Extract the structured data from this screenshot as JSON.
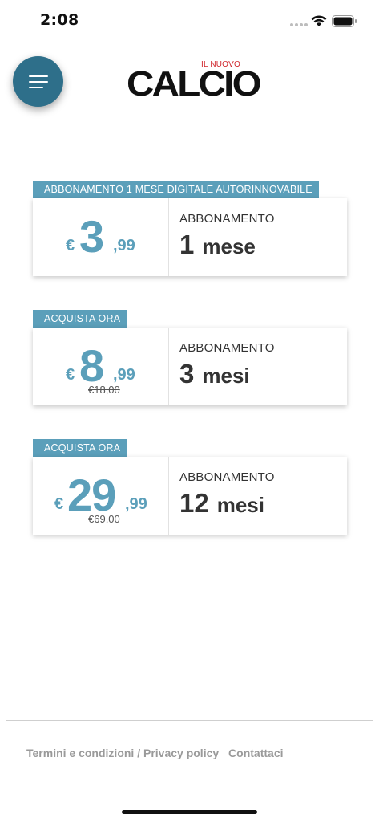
{
  "status_bar": {
    "time": "2:08"
  },
  "header": {
    "menu_icon": "hamburger-menu-icon",
    "logo_small": "IL NUOVO",
    "logo_main": "CALCIO"
  },
  "plans": [
    {
      "label": "ABBONAMENTO 1 MESE DIGITALE AUTORINNOVABILE",
      "currency": "€",
      "price_int": "3",
      "price_dec": ",99",
      "old_price": "",
      "title": "ABBONAMENTO",
      "duration_num": "1",
      "duration_unit": "mese"
    },
    {
      "label": "ACQUISTA ORA",
      "currency": "€",
      "price_int": "8",
      "price_dec": ",99",
      "old_price": "€18,00",
      "title": "ABBONAMENTO",
      "duration_num": "3",
      "duration_unit": "mesi"
    },
    {
      "label": "ACQUISTA ORA",
      "currency": "€",
      "price_int": "29",
      "price_dec": ",99",
      "old_price": "€69,00",
      "title": "ABBONAMENTO",
      "duration_num": "12",
      "duration_unit": "mesi"
    }
  ],
  "footer": {
    "terms": "Termini e condizioni",
    "separator": "/",
    "privacy": "Privacy policy",
    "contact": "Contattaci"
  },
  "colors": {
    "accent": "#5b9fba",
    "menu_button": "#2e6f8a",
    "logo_red": "#d0282e"
  }
}
